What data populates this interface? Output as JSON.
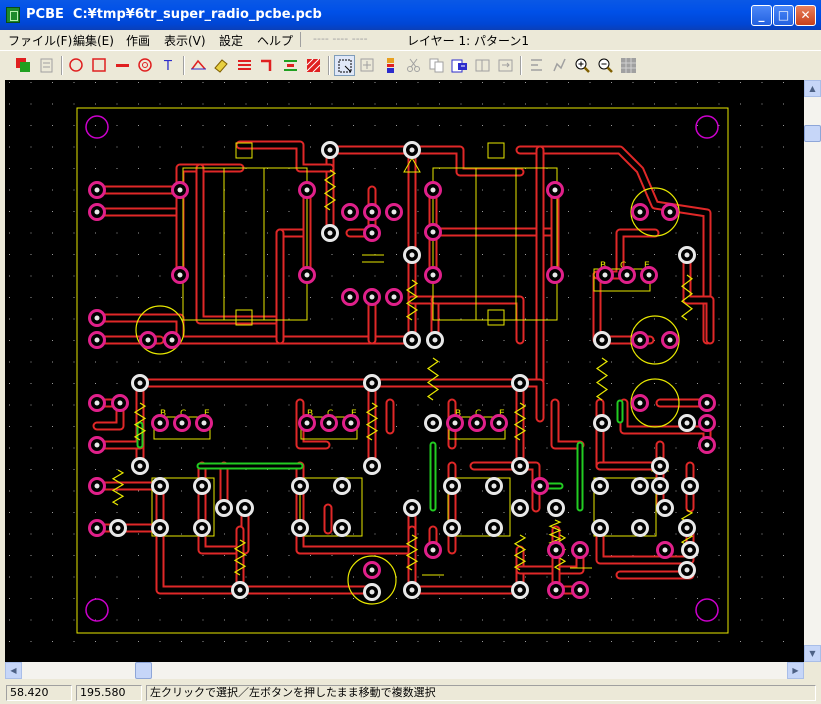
{
  "title": {
    "app": "PCBE",
    "path": "C:¥tmp¥6tr_super_radio_pcbe.pcb"
  },
  "window_buttons": {
    "minimize": "_",
    "maximize": "□",
    "close": "✕"
  },
  "menu": {
    "items": [
      "ファイル(F)",
      "編集(E)",
      "作画",
      "表示(V)",
      "設定",
      "ヘルプ"
    ],
    "disabled": "---- ---- ----",
    "layer": "レイヤー 1: パターン1"
  },
  "toolbar": {
    "icons": [
      "layers-icon",
      "page-icon",
      "circle-icon",
      "rectangle-icon",
      "line-icon",
      "target-icon",
      "text-icon",
      "angle-icon",
      "eraser-icon",
      "multiline-icon",
      "corner-icon",
      "align-icon",
      "hatch-icon",
      "select-icon",
      "move-icon",
      "grid-icon",
      "cut-icon",
      "copy-icon",
      "paste-icon",
      "mirror-icon",
      "flip-icon",
      "rotate-icon",
      "edit-icon",
      "zoom-in-icon",
      "zoom-out-icon",
      "fit-icon"
    ],
    "accent": "#2C2CCC"
  },
  "board": {
    "transistor_labels": [
      "B",
      "C",
      "E"
    ],
    "colors": {
      "trace": "#E02828",
      "pad": "#E0208A",
      "silk": "#E8E800",
      "jumper": "#22CC22",
      "board_outline": "#E8E800",
      "mount_hole": "#CC00CC"
    }
  },
  "status": {
    "x": "58.420",
    "y": "195.580",
    "hint": "左クリックで選択／左ボタンを押したまま移動で複数選択"
  }
}
